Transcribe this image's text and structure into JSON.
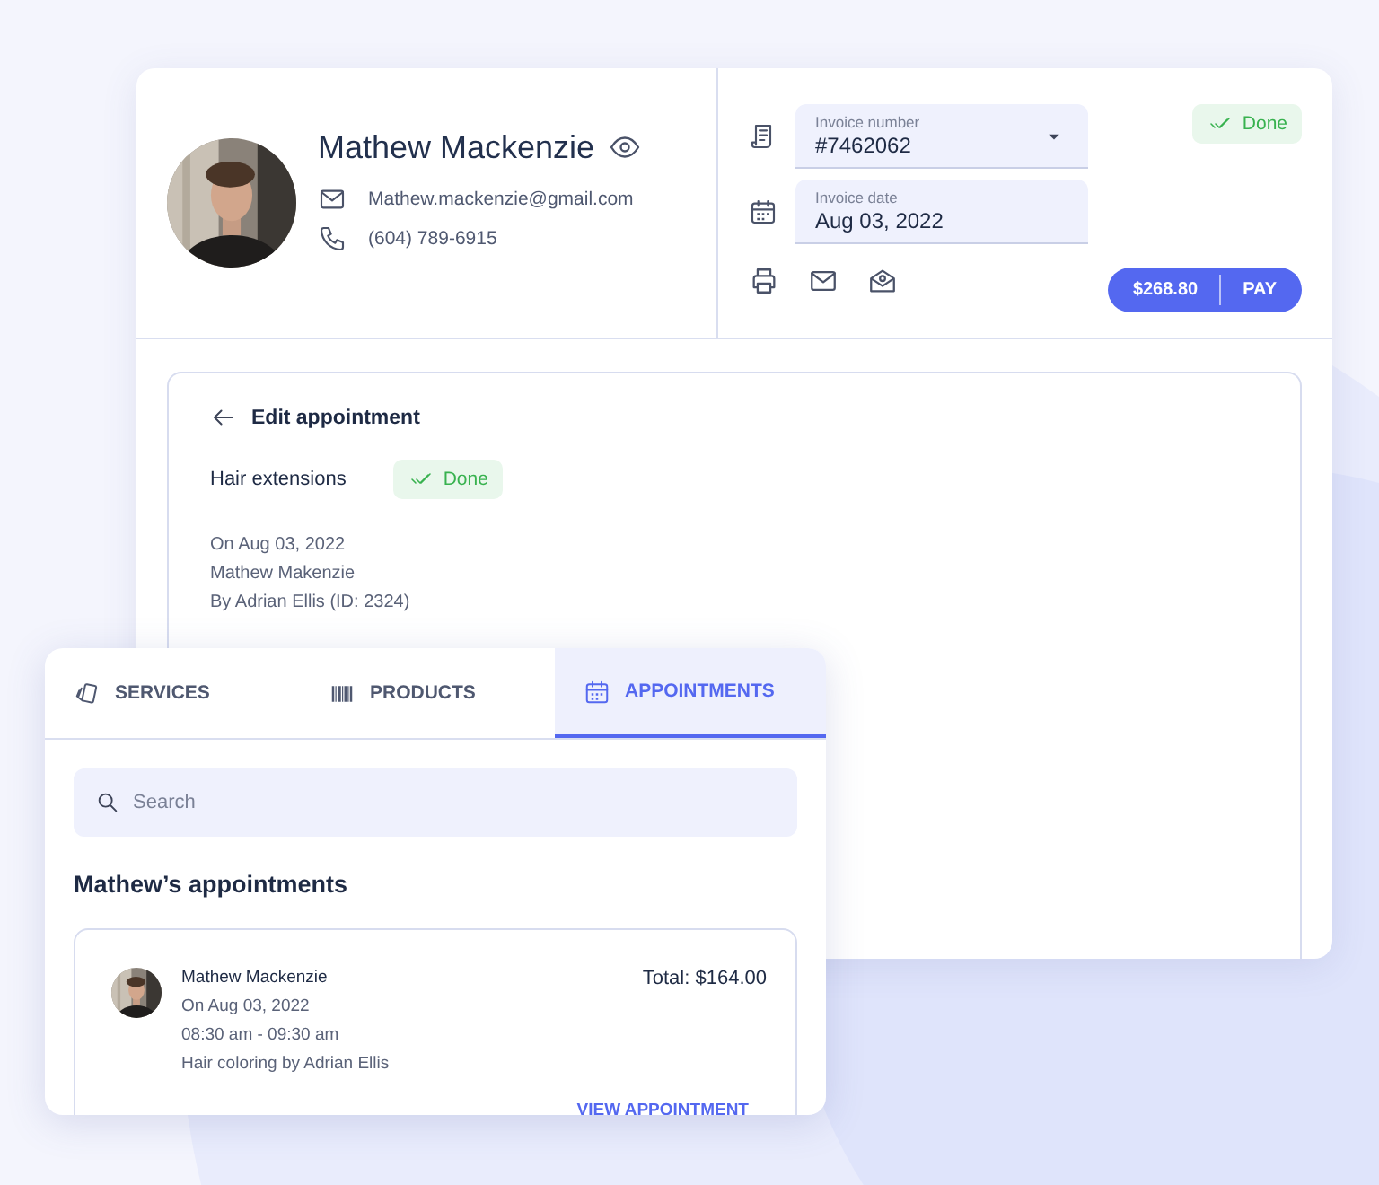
{
  "customer": {
    "name": "Mathew Mackenzie",
    "email": "Mathew.mackenzie@gmail.com",
    "phone": "(604) 789-6915"
  },
  "invoice": {
    "fields": [
      {
        "label": "Invoice number",
        "value": "#7462062",
        "dropdown": true
      },
      {
        "label": "Invoice date",
        "value": "Aug 03, 2022",
        "dropdown": false
      }
    ],
    "status": "Done",
    "amount": "$268.80",
    "pay": "PAY"
  },
  "appointment_detail": {
    "title": "Edit appointment",
    "service": "Hair extensions",
    "status": "Done",
    "lines": [
      "On Aug 03, 2022",
      "Mathew Makenzie",
      "By Adrian Ellis (ID: 2324)"
    ]
  },
  "panel": {
    "tabs": [
      {
        "label": "SERVICES",
        "selected": false
      },
      {
        "label": "PRODUCTS",
        "selected": false
      },
      {
        "label": "APPOINTMENTS",
        "selected": true
      }
    ],
    "search": {
      "placeholder": "Search"
    },
    "heading": "Mathew’s appointments",
    "appointments": [
      {
        "name": "Mathew Mackenzie",
        "lines": [
          "On Aug 03, 2022",
          "08:30 am - 09:30 am",
          "Hair coloring by Adrian Ellis"
        ],
        "total": "Total: $164.00",
        "action": "VIEW APPOINTMENT"
      }
    ]
  }
}
